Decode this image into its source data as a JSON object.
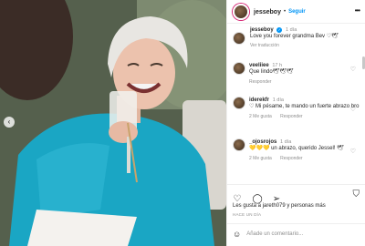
{
  "post": {
    "username": "jesseboy",
    "follow_label": "Seguir",
    "more_label": "•••"
  },
  "caption": {
    "username": "jesseboy",
    "time": "1 día",
    "text": "Love you forever grandma Bev ♡🕊",
    "translate_label": "Ver traducción"
  },
  "comments": [
    {
      "username": "veeliiee",
      "time": "17 h",
      "text": "Que lindo🕊🕊🕊",
      "likes": "",
      "reply": "Responder"
    },
    {
      "username": "iderekfr",
      "time": "1 día",
      "text": "♡ Mi pésame, te mando un fuerte abrazo bro",
      "likes": "2 Me gusta",
      "reply": "Responder"
    },
    {
      "username": "_ojosrojos",
      "time": "1 día",
      "text": "💛💛💛 un abrazo, querido Jessel! 🕊",
      "likes": "2 Me gusta",
      "reply": "Responder"
    }
  ],
  "footer": {
    "likes_text": "Les gusta a jareth079 y personas más",
    "date": "HACE UN DÍA",
    "add_comment_placeholder": "Añade un comentario..."
  },
  "icons": [
    "heart-icon",
    "comment-icon",
    "share-icon",
    "bookmark-icon",
    "emoji-icon",
    "verified-icon",
    "more-icon",
    "previous-arrow-icon"
  ],
  "colors": {
    "accent": "#0095f6",
    "text": "#262626",
    "muted": "#8e8e8e"
  }
}
